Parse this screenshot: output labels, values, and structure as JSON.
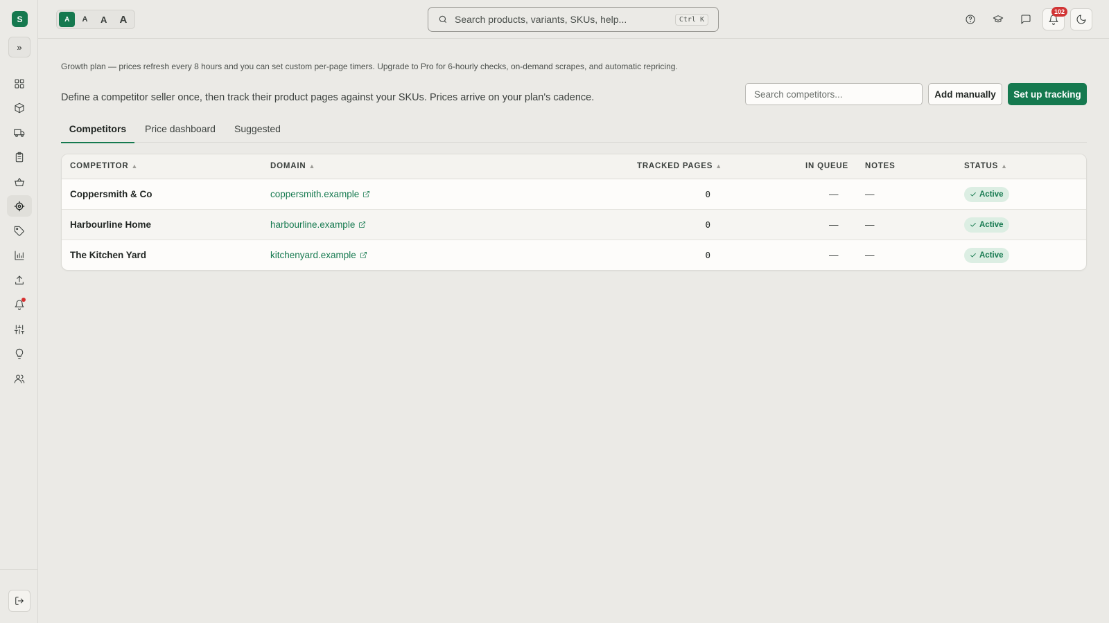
{
  "sidebar": {
    "logo_letter": "S",
    "expand_icon": "chevrons-right-icon",
    "items": [
      {
        "name": "dashboard",
        "icon": "grid-icon"
      },
      {
        "name": "products",
        "icon": "box-icon"
      },
      {
        "name": "shipping",
        "icon": "truck-icon"
      },
      {
        "name": "orders",
        "icon": "clipboard-icon"
      },
      {
        "name": "baskets",
        "icon": "basket-icon"
      },
      {
        "name": "competitors",
        "icon": "target-icon",
        "active": true
      },
      {
        "name": "pricing",
        "icon": "tag-icon"
      },
      {
        "name": "analytics",
        "icon": "bar-chart-icon"
      },
      {
        "name": "uploads",
        "icon": "upload-icon"
      },
      {
        "name": "alerts",
        "icon": "bell-icon",
        "has_dot": true
      },
      {
        "name": "settings",
        "icon": "sliders-icon"
      },
      {
        "name": "tips",
        "icon": "lightbulb-icon"
      },
      {
        "name": "team",
        "icon": "users-icon"
      }
    ],
    "logout_icon": "logout-icon"
  },
  "topbar": {
    "font_sizes": [
      "A",
      "A",
      "A",
      "A"
    ],
    "search_placeholder": "Search products, variants, SKUs, help...",
    "search_shortcut": "Ctrl K",
    "notification_count": "102"
  },
  "page": {
    "plan_note": "Growth plan — prices refresh every 8 hours and you can set custom per-page timers. Upgrade to Pro for 6-hourly checks, on-demand scrapes, and automatic repricing.",
    "intro": "Define a competitor seller once, then track their product pages against your SKUs. Prices arrive on your plan's cadence.",
    "competitor_search_placeholder": "Search competitors...",
    "add_manually_label": "Add manually",
    "set_up_tracking_label": "Set up tracking",
    "tabs": [
      {
        "label": "Competitors",
        "active": true
      },
      {
        "label": "Price dashboard"
      },
      {
        "label": "Suggested"
      }
    ]
  },
  "table": {
    "columns": {
      "competitor": "COMPETITOR",
      "domain": "DOMAIN",
      "tracked_pages": "TRACKED PAGES",
      "in_queue": "IN QUEUE",
      "notes": "NOTES",
      "status": "STATUS"
    },
    "rows": [
      {
        "name": "Coppersmith & Co",
        "domain": "coppersmith.example",
        "tracked_pages": "0",
        "in_queue": "—",
        "notes": "—",
        "status": "Active"
      },
      {
        "name": "Harbourline Home",
        "domain": "harbourline.example",
        "tracked_pages": "0",
        "in_queue": "—",
        "notes": "—",
        "status": "Active"
      },
      {
        "name": "The Kitchen Yard",
        "domain": "kitchenyard.example",
        "tracked_pages": "0",
        "in_queue": "—",
        "notes": "—",
        "status": "Active"
      }
    ]
  },
  "colors": {
    "brand": "#15794f",
    "background": "#ebeae6",
    "badge_red": "#d13434"
  }
}
